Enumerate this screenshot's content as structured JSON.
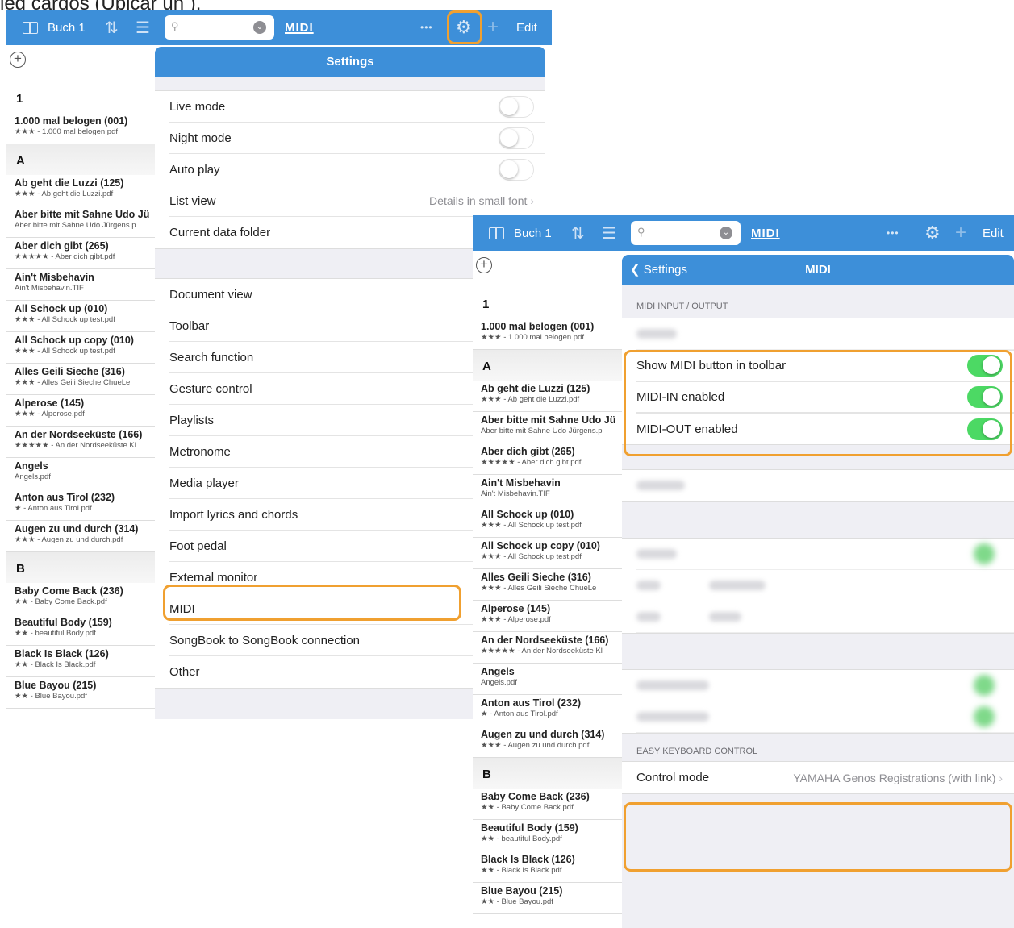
{
  "caption": "leg cardos (Ubicar un ).",
  "toolbar": {
    "book": "Buch 1",
    "midi": "MIDI",
    "dots": "•••",
    "edit": "Edit",
    "plus": "+"
  },
  "sidebar": {
    "sections": [
      {
        "header": "1",
        "items": [
          {
            "title": "1.000 mal belogen (001)",
            "sub": "★★★ - 1.000 mal belogen.pdf"
          }
        ]
      },
      {
        "header": "A",
        "items": [
          {
            "title": "Ab geht die Luzzi (125)",
            "sub": "★★★ - Ab geht die Luzzi.pdf"
          },
          {
            "title": "Aber bitte mit Sahne Udo Jü",
            "sub": "Aber bitte mit Sahne Udo Jürgens.p"
          },
          {
            "title": "Aber dich gibt (265)",
            "sub": "★★★★★ - Aber dich gibt.pdf"
          },
          {
            "title": "Ain't Misbehavin",
            "sub": "Ain't Misbehavin.TIF"
          },
          {
            "title": "All Schock up (010)",
            "sub": "★★★ - All Schock up test.pdf"
          },
          {
            "title": "All Schock up copy (010)",
            "sub": "★★★ - All Schock up test.pdf"
          },
          {
            "title": "Alles Geili Sieche (316)",
            "sub": "★★★ - Alles Geili Sieche   ChueLe"
          },
          {
            "title": "Alperose (145)",
            "sub": "★★★ - Alperose.pdf"
          },
          {
            "title": "An der Nordseeküste (166)",
            "sub": "★★★★★ - An der Nordseeküste Kl"
          },
          {
            "title": "Angels",
            "sub": "Angels.pdf"
          },
          {
            "title": "Anton aus Tirol (232)",
            "sub": "★ - Anton aus Tirol.pdf"
          },
          {
            "title": "Augen zu und durch (314)",
            "sub": "★★★ - Augen zu und durch.pdf"
          }
        ]
      },
      {
        "header": "B",
        "items": [
          {
            "title": "Baby Come Back (236)",
            "sub": "★★ - Baby Come Back.pdf"
          },
          {
            "title": "Beautiful Body (159)",
            "sub": "★★ - beautiful Body.pdf"
          },
          {
            "title": "Black Is Black (126)",
            "sub": "★★ - Black Is Black.pdf"
          },
          {
            "title": "Blue Bayou (215)",
            "sub": "★★ - Blue Bayou.pdf"
          }
        ]
      }
    ]
  },
  "settings": {
    "title": "Settings",
    "group1": [
      {
        "label": "Live mode",
        "toggle": false
      },
      {
        "label": "Night mode",
        "toggle": false
      },
      {
        "label": "Auto play",
        "toggle": false
      },
      {
        "label": "List view",
        "detail": "Details in small font"
      },
      {
        "label": "Current data folder",
        "detail": "I"
      }
    ],
    "group2": [
      "Document view",
      "Toolbar",
      "Search function",
      "Gesture control",
      "Playlists",
      "Metronome",
      "Media player",
      "Import lyrics and chords",
      "Foot pedal",
      "External monitor",
      "MIDI",
      "SongBook to SongBook connection",
      "Other"
    ]
  },
  "midi": {
    "back": "Settings",
    "title": "MIDI",
    "io_header": "MIDI INPUT / OUTPUT",
    "rows": [
      {
        "label": "Show MIDI button in toolbar",
        "toggle": true
      },
      {
        "label": "MIDI-IN enabled",
        "toggle": true
      },
      {
        "label": "MIDI-OUT enabled",
        "toggle": true
      }
    ],
    "ekc_header": "EASY KEYBOARD CONTROL",
    "control_label": "Control mode",
    "control_value": "YAMAHA Genos Registrations (with link)"
  },
  "colors": {
    "toolbar": "#3d8fd9",
    "highlight": "#f0a030",
    "toggle_on": "#4cd964"
  }
}
